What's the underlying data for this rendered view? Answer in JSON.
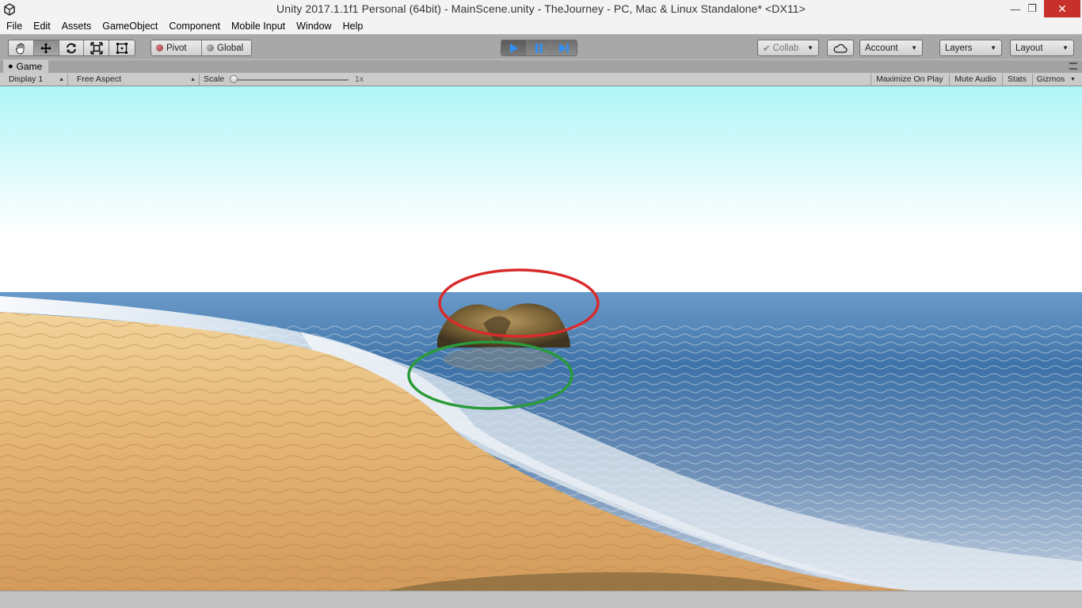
{
  "window": {
    "title": "Unity 2017.1.1f1 Personal (64bit) - MainScene.unity - TheJourney - PC, Mac & Linux Standalone* <DX11>",
    "minimize_icon": "minimize-icon",
    "maximize_icon": "restore-icon",
    "close_icon": "close-icon"
  },
  "menu": {
    "items": [
      "File",
      "Edit",
      "Assets",
      "GameObject",
      "Component",
      "Mobile Input",
      "Window",
      "Help"
    ]
  },
  "toolbar": {
    "transform_tools": [
      "hand-tool-icon",
      "move-tool-icon",
      "rotate-tool-icon",
      "scale-tool-icon",
      "rect-tool-icon"
    ],
    "active_tool": "move-tool-icon",
    "pivot_label": "Pivot",
    "global_label": "Global",
    "play_controls": [
      "play-icon",
      "pause-icon",
      "step-icon"
    ],
    "collab_label": "Collab",
    "account_label": "Account",
    "layers_label": "Layers",
    "layout_label": "Layout"
  },
  "game_panel": {
    "tab_label": "Game",
    "display_label": "Display 1",
    "aspect_label": "Free Aspect",
    "scale_label": "Scale",
    "scale_value": "1x",
    "maximize_on_play": "Maximize On Play",
    "mute_audio": "Mute Audio",
    "stats": "Stats",
    "gizmos": "Gizmos"
  },
  "scene": {
    "description_colors": {
      "sky_top": "#b2f4f6",
      "sky_horizon": "#ffffff",
      "sea": "#3a6fa3",
      "sand": "#e6b878",
      "annotation_red": "#d92b2b",
      "annotation_green": "#2a9a3a"
    }
  }
}
